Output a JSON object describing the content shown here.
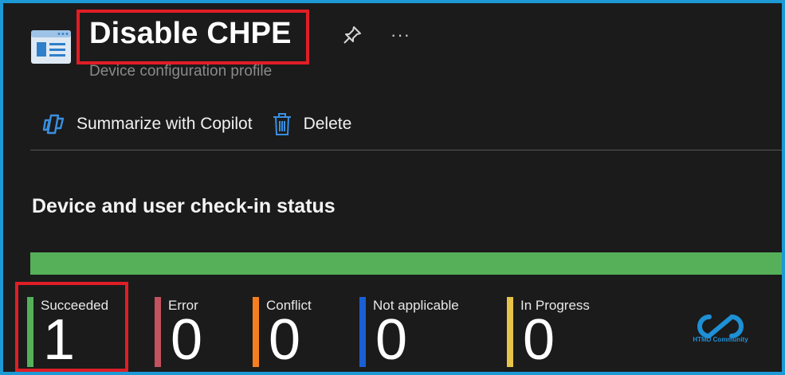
{
  "header": {
    "title": "Disable CHPE",
    "subtitle": "Device configuration profile",
    "app_icon": "profile-icon",
    "pin_icon": "pin-icon",
    "more_label": "···"
  },
  "toolbar": {
    "copilot_label": "Summarize with Copilot",
    "copilot_icon": "copilot-icon",
    "delete_label": "Delete",
    "delete_icon": "trash-icon"
  },
  "status": {
    "title": "Device and user check-in status",
    "succeeded_fraction": 1.0,
    "items": [
      {
        "label": "Succeeded",
        "value": "1",
        "color": "#56b05a"
      },
      {
        "label": "Error",
        "value": "0",
        "color": "#c2535e"
      },
      {
        "label": "Conflict",
        "value": "0",
        "color": "#f57f20"
      },
      {
        "label": "Not applicable",
        "value": "0",
        "color": "#1a5fd6"
      },
      {
        "label": "In Progress",
        "value": "0",
        "color": "#e6c44a"
      }
    ]
  },
  "watermark": {
    "text": "HTMD Community",
    "color": "#1e90d6"
  },
  "highlight_color": "#e01e26"
}
